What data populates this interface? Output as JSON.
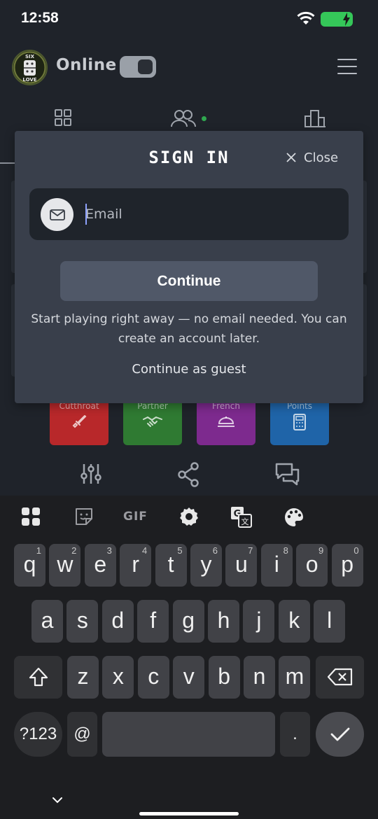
{
  "status_bar": {
    "time": "12:58"
  },
  "header": {
    "status_label": "Online",
    "logo_text": "SIX LOVE"
  },
  "tabs": [
    {
      "icon": "grid-icon"
    },
    {
      "icon": "users-icon",
      "active_dot": true
    },
    {
      "icon": "buildings-icon"
    }
  ],
  "game_modes": [
    {
      "label": "Cutthroat",
      "color": "#b8282a",
      "icon": "sword-icon"
    },
    {
      "label": "Partner",
      "color": "#2f7a32",
      "icon": "handshake-icon"
    },
    {
      "label": "French",
      "color": "#7d2a8e",
      "icon": "dish-icon"
    },
    {
      "label": "Points",
      "color": "#1f64a8",
      "icon": "calculator-icon"
    }
  ],
  "bottom_icons": [
    "sliders-icon",
    "share-icon",
    "chat-icon"
  ],
  "modal": {
    "title": "SIGN IN",
    "close_label": "Close",
    "email_placeholder": "Email",
    "continue_label": "Continue",
    "helper_text": "Start playing right away — no email needed. You can create an account later.",
    "guest_label": "Continue as guest"
  },
  "keyboard": {
    "toolbar": [
      "apps-icon",
      "sticker-icon",
      "GIF",
      "settings-icon",
      "translate-icon",
      "palette-icon"
    ],
    "row1": [
      {
        "k": "q",
        "n": "1"
      },
      {
        "k": "w",
        "n": "2"
      },
      {
        "k": "e",
        "n": "3"
      },
      {
        "k": "r",
        "n": "4"
      },
      {
        "k": "t",
        "n": "5"
      },
      {
        "k": "y",
        "n": "6"
      },
      {
        "k": "u",
        "n": "7"
      },
      {
        "k": "i",
        "n": "8"
      },
      {
        "k": "o",
        "n": "9"
      },
      {
        "k": "p",
        "n": "0"
      }
    ],
    "row2": [
      "a",
      "s",
      "d",
      "f",
      "g",
      "h",
      "j",
      "k",
      "l"
    ],
    "row3": [
      "z",
      "x",
      "c",
      "v",
      "b",
      "n",
      "m"
    ],
    "symbols_label": "?123",
    "at_label": "@",
    "period_label": "."
  }
}
